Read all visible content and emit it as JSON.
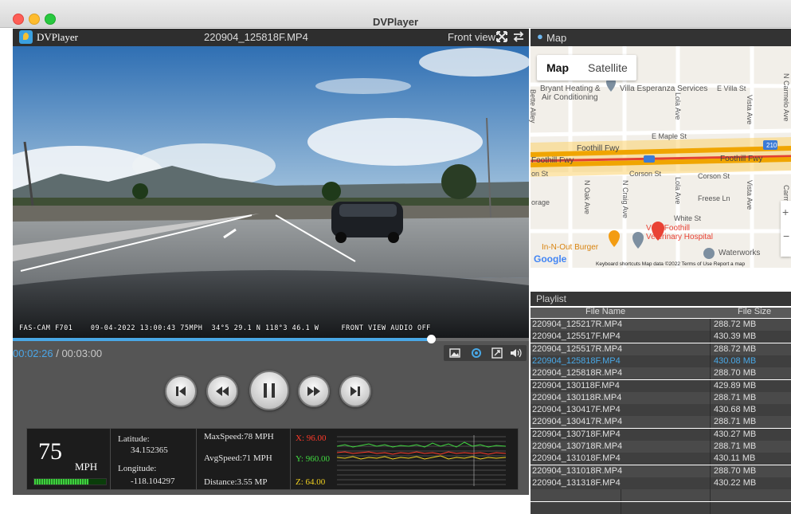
{
  "window": {
    "title": "DVPlayer"
  },
  "player": {
    "app_name": "DVPlayer",
    "file_title": "220904_125818F.MP4",
    "view_label": "Front view",
    "osd_text": "FAS-CAM F701    09-04-2022 13:00:43 75MPH  34°5 29.1 N 118°3 46.1 W     FRONT VIEW AUDIO OFF",
    "progress_fraction": 0.81,
    "time_current": "00:02:26",
    "time_separator": " / ",
    "time_total": "00:03:00"
  },
  "controls": [
    "skip-previous-icon",
    "rewind-icon",
    "pause-icon",
    "fast-forward-icon",
    "skip-next-icon"
  ],
  "tools": [
    "snapshot-icon",
    "rotate-icon",
    "fullscreen-icon",
    "volume-icon"
  ],
  "telemetry": {
    "speed_value": "75",
    "speed_unit": "MPH",
    "speed_level": 0.75,
    "latitude_label": "Latitude:",
    "latitude_value": "34.152365",
    "longitude_label": "Longitude:",
    "longitude_value": "-118.104297",
    "max_speed": "MaxSpeed:78 MPH",
    "avg_speed": "AvgSpeed:71 MPH",
    "distance": "Distance:3.55 MP",
    "gsensor_x": "X: 96.00",
    "gsensor_y": "Y: 960.00",
    "gsensor_z": "Z: 64.00"
  },
  "map": {
    "header": "Map",
    "tab_map": "Map",
    "tab_satellite": "Satellite",
    "labels": {
      "bryant": "Bryant Heating &",
      "air": "Air Conditioning",
      "villa": "Villa Esperanza Services",
      "e_villa": "E Villa St",
      "e_maple": "E Maple St",
      "foothill_fwy_1": "Foothill Fwy",
      "foothill_fwy_2": "Foothill Fwy",
      "foothill_fwy_3": "Foothill Fwy",
      "corson_1": "Corson St",
      "corson_2": "Corson St",
      "corson_3": "on St",
      "freese": "Freese Ln",
      "white": "White St",
      "torage": "orage",
      "vca_1": "VCA Foothill",
      "vca_2": "Veterinary Hospital",
      "innout": "In-N-Out Burger",
      "waterworks": "Waterworks",
      "lola_1": "Lola Ave",
      "lola_2": "Lola Ave",
      "vista_1": "Vista Ave",
      "vista_2": "Vista Ave",
      "oak": "N Oak Ave",
      "craig": "N Craig Ave",
      "carmelo": "N Carmelo Ave",
      "bette": "Bette Alley",
      "carm": "Carm",
      "hwy210": "210"
    },
    "google": "Google",
    "footer": "Keyboard shortcuts   Map data ©2022   Terms of Use   Report a map"
  },
  "playlist": {
    "title": "Playlist",
    "col_name": "File Name",
    "col_size": "File Size",
    "rows": [
      {
        "name": "220904_125217R.MP4",
        "size": "288.72 MB"
      },
      {
        "name": "220904_125517F.MP4",
        "size": "430.39 MB"
      },
      {
        "name": "220904_125517R.MP4",
        "size": "288.72 MB"
      },
      {
        "name": "220904_125818F.MP4",
        "size": "430.08 MB"
      },
      {
        "name": "220904_125818R.MP4",
        "size": "288.70 MB"
      },
      {
        "name": "220904_130118F.MP4",
        "size": "429.89 MB"
      },
      {
        "name": "220904_130118R.MP4",
        "size": "288.71 MB"
      },
      {
        "name": "220904_130417F.MP4",
        "size": "430.68 MB"
      },
      {
        "name": "220904_130417R.MP4",
        "size": "288.71 MB"
      },
      {
        "name": "220904_130718F.MP4",
        "size": "430.27 MB"
      },
      {
        "name": "220904_130718R.MP4",
        "size": "288.71 MB"
      },
      {
        "name": "220904_131018F.MP4",
        "size": "430.11 MB"
      },
      {
        "name": "220904_131018R.MP4",
        "size": "288.70 MB"
      },
      {
        "name": "220904_131318F.MP4",
        "size": "430.22 MB"
      }
    ],
    "selected_index": 3
  },
  "colors": {
    "accent": "#49a8e6",
    "panel": "#555555",
    "dark": "#2e2e2e"
  }
}
